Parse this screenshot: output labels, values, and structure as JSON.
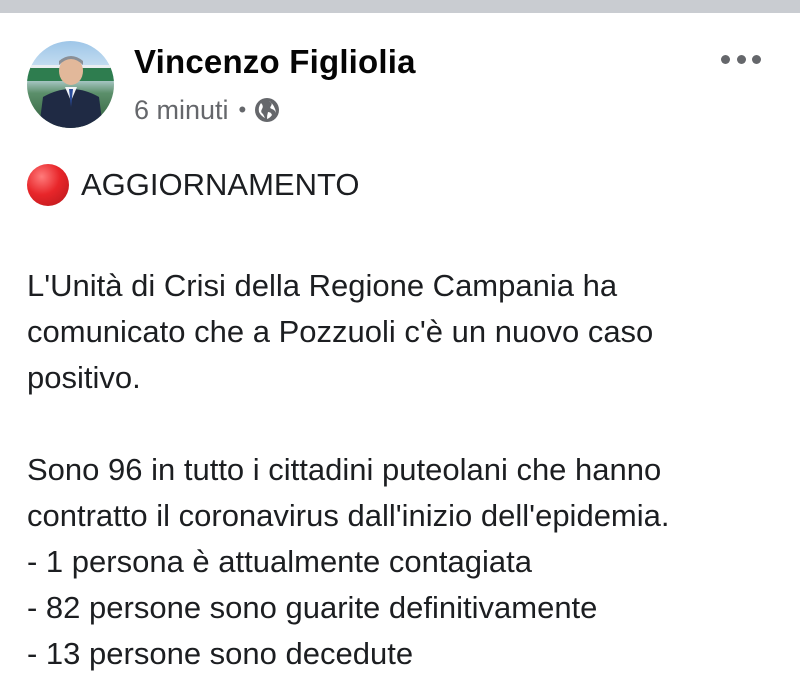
{
  "post": {
    "author": "Vincenzo Figliolia",
    "time": "6 minuti",
    "separator": "•",
    "visibility_icon": "globe-icon",
    "menu_icon": "more-options-icon",
    "headline_icon": "red-circle-icon",
    "headline": "AGGIORNAMENTO",
    "paragraph1": [
      "L'Unità di Crisi della Regione Campania ha",
      "comunicato che a Pozzuoli c'è un nuovo caso",
      "positivo."
    ],
    "paragraph2": [
      "Sono 96 in tutto i cittadini puteolani che hanno",
      "contratto il coronavirus dall'inizio dell'epidemia.",
      "- 1 persona è attualmente contagiata",
      "- 82 persone sono guarite definitivamente",
      "- 13 persone sono decedute"
    ]
  },
  "colors": {
    "secondary_text": "#65676b",
    "primary_text": "#1c1e21",
    "red_circle": "#e8262a"
  }
}
